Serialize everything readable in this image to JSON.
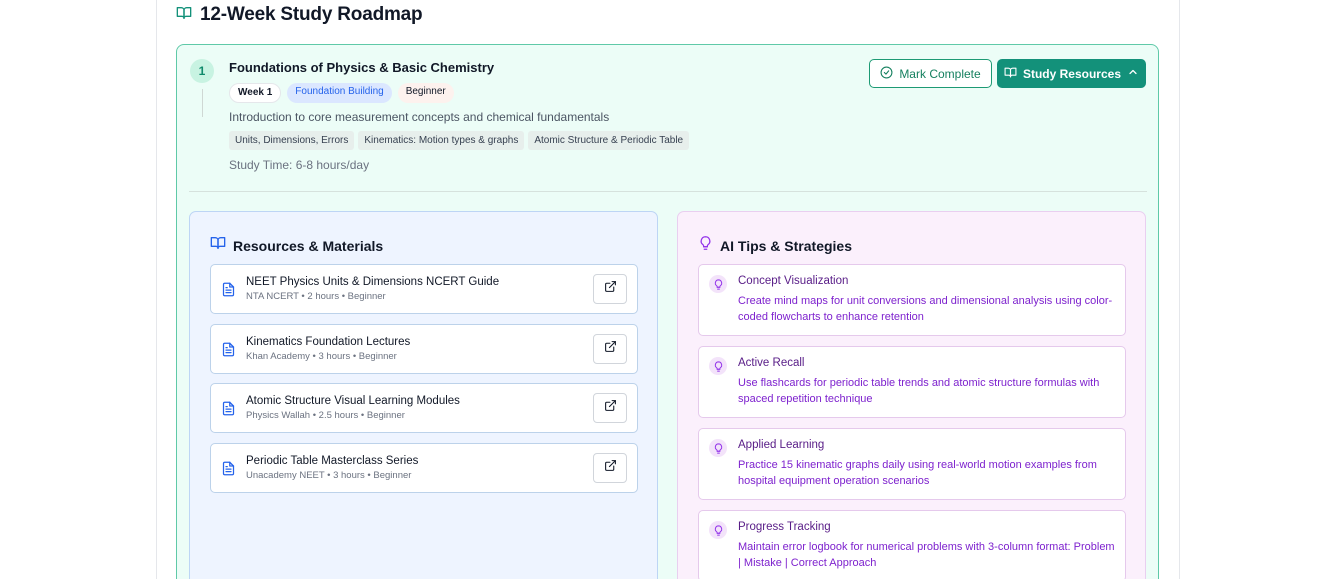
{
  "page": {
    "title": "12-Week Study Roadmap"
  },
  "week": {
    "number": "1",
    "title": "Foundations of Physics & Basic Chemistry",
    "badges": {
      "week": "Week 1",
      "phase": "Foundation Building",
      "level": "Beginner"
    },
    "description": "Introduction to core measurement concepts and chemical fundamentals",
    "topics": [
      "Units, Dimensions, Errors",
      "Kinematics: Motion types & graphs",
      "Atomic Structure & Periodic Table"
    ],
    "study_time": "Study Time: 6-8 hours/day",
    "actions": {
      "mark_complete": "Mark Complete",
      "study_resources": "Study Resources"
    }
  },
  "resources_panel": {
    "title": "Resources & Materials",
    "items": [
      {
        "title": "NEET Physics Units & Dimensions NCERT Guide",
        "meta": "NTA NCERT • 2 hours • Beginner"
      },
      {
        "title": "Kinematics Foundation Lectures",
        "meta": "Khan Academy • 3 hours • Beginner"
      },
      {
        "title": "Atomic Structure Visual Learning Modules",
        "meta": "Physics Wallah • 2.5 hours • Beginner"
      },
      {
        "title": "Periodic Table Masterclass Series",
        "meta": "Unacademy NEET • 3 hours • Beginner"
      }
    ]
  },
  "tips_panel": {
    "title": "AI Tips & Strategies",
    "items": [
      {
        "title": "Concept Visualization",
        "text": "Create mind maps for unit conversions and dimensional analysis using color-coded flowcharts to enhance retention"
      },
      {
        "title": "Active Recall",
        "text": "Use flashcards for periodic table trends and atomic structure formulas with spaced repetition technique"
      },
      {
        "title": "Applied Learning",
        "text": "Practice 15 kinematic graphs daily using real-world motion examples from hospital equipment operation scenarios"
      },
      {
        "title": "Progress Tracking",
        "text": "Maintain error logbook for numerical problems with 3-column format: Problem | Mistake | Correct Approach"
      }
    ]
  },
  "colors": {
    "accent": "#13917a",
    "card_bg": "#ecfdf7",
    "resources_bg": "#eef4ff",
    "tips_bg": "#fbf0fc"
  },
  "icons": {
    "title": "book-open-icon",
    "mark_complete": "check-circle-icon",
    "study_resources": "book-open-icon",
    "collapse": "chevron-up-icon",
    "resource_item": "document-icon",
    "external_link": "external-link-icon",
    "tip_item": "lightbulb-icon"
  }
}
